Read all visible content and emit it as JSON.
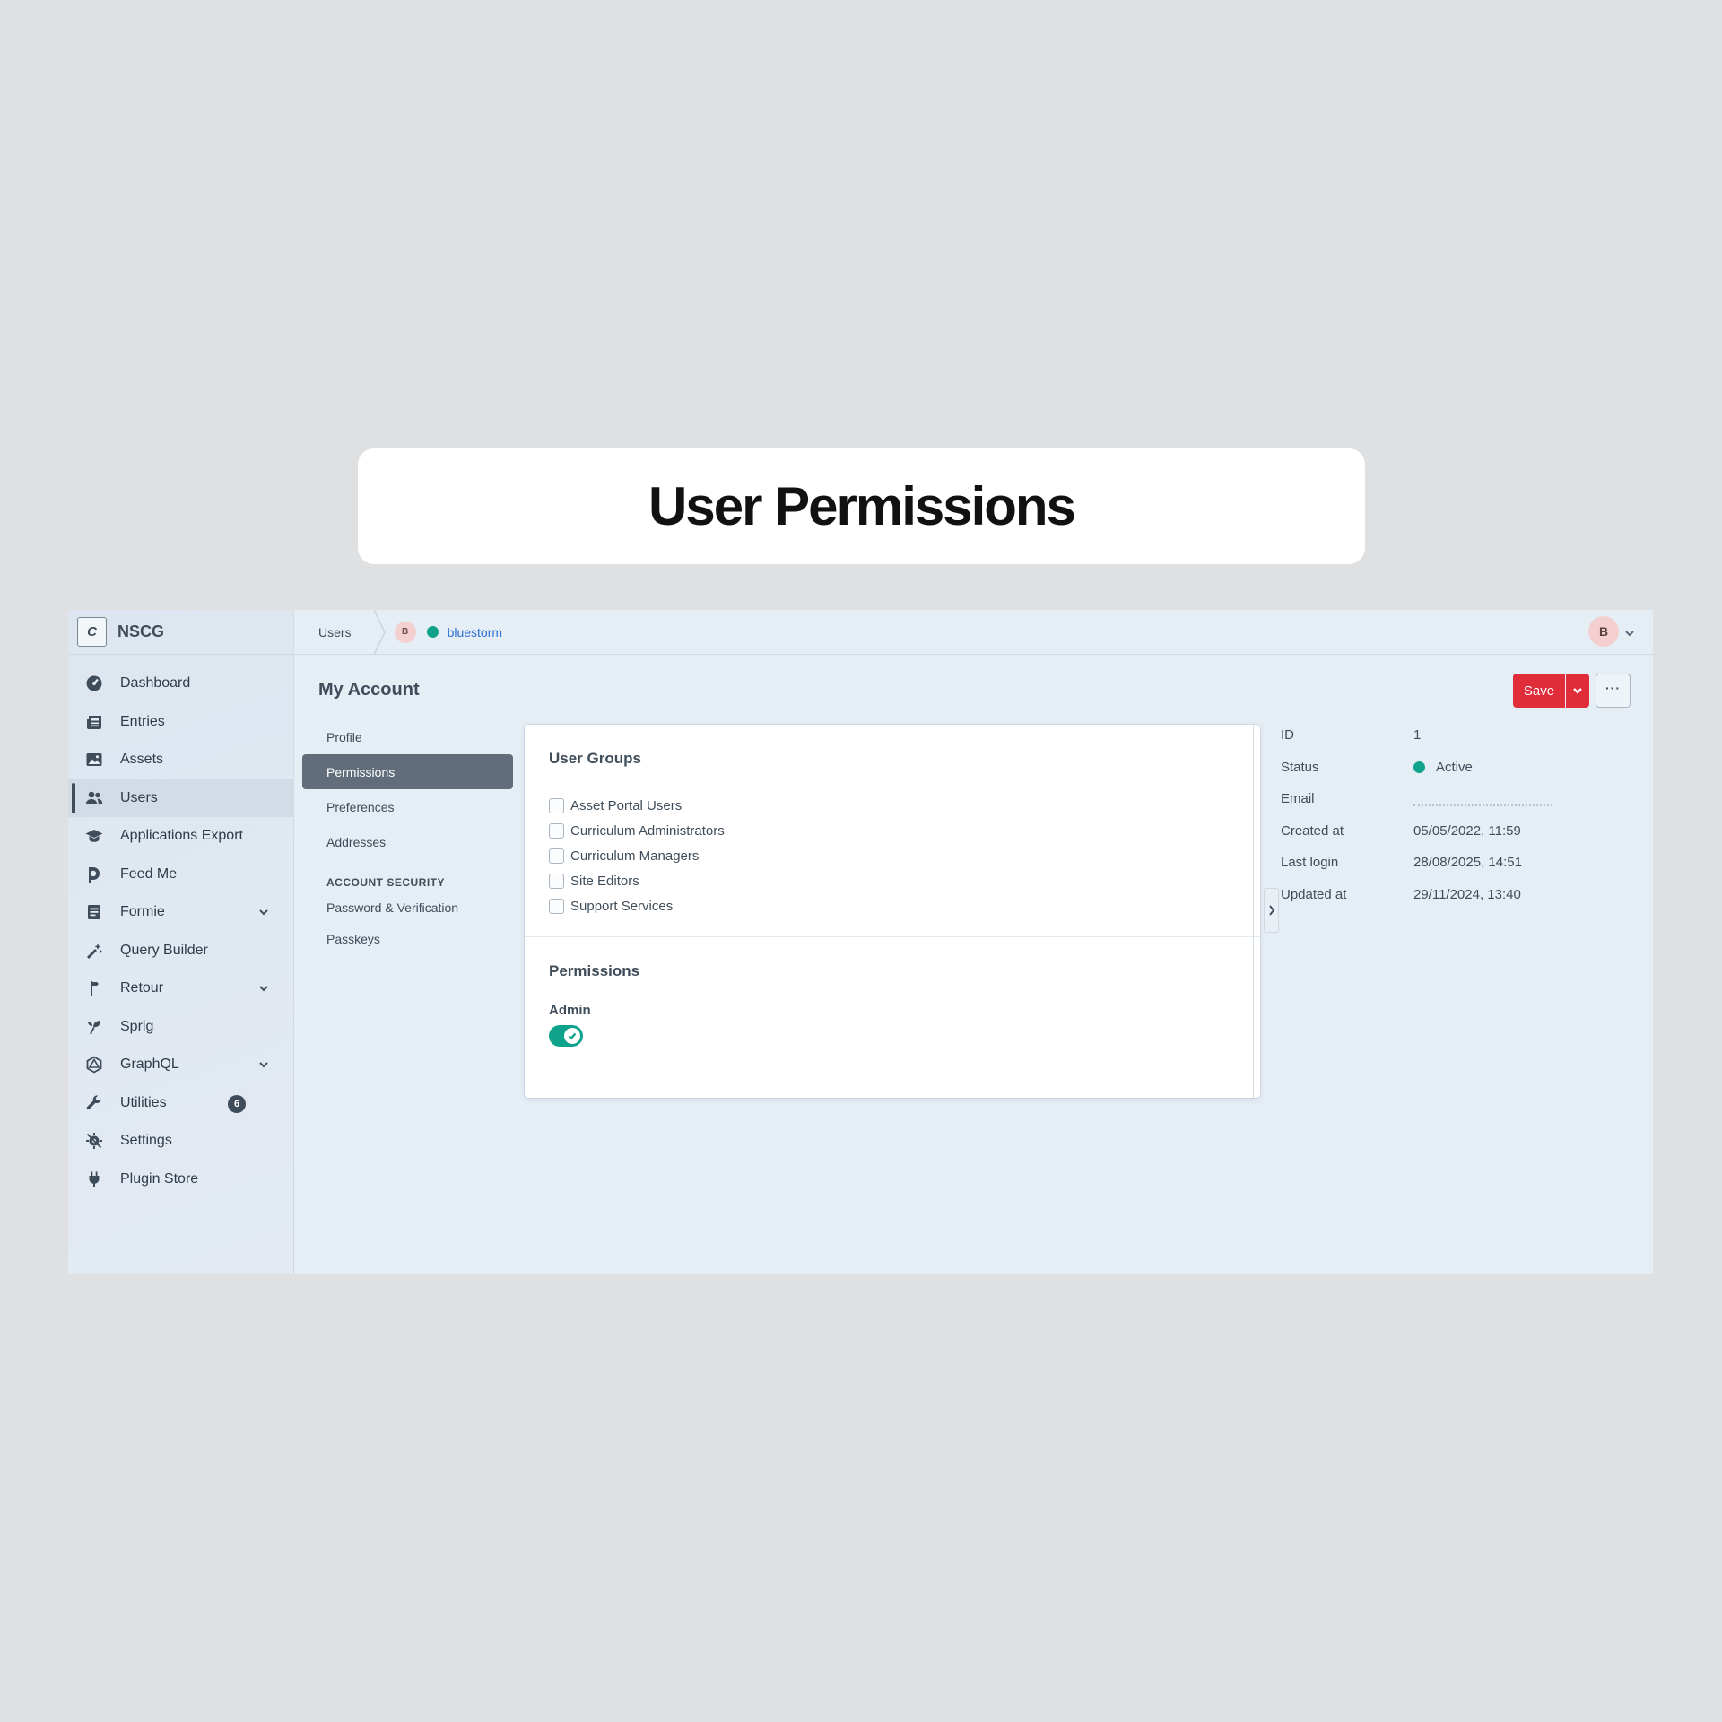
{
  "hero": {
    "title": "User Permissions"
  },
  "brand": {
    "logo": "C",
    "name": "NSCG"
  },
  "sidebar": {
    "items": [
      {
        "label": "Dashboard",
        "icon": "gauge-icon"
      },
      {
        "label": "Entries",
        "icon": "newspaper-icon"
      },
      {
        "label": "Assets",
        "icon": "image-icon"
      },
      {
        "label": "Users",
        "icon": "users-icon",
        "active": true
      },
      {
        "label": "Applications Export",
        "icon": "graduation-cap-icon"
      },
      {
        "label": "Feed Me",
        "icon": "feed-icon"
      },
      {
        "label": "Formie",
        "icon": "form-icon",
        "expandable": true
      },
      {
        "label": "Query Builder",
        "icon": "wand-icon"
      },
      {
        "label": "Retour",
        "icon": "signpost-icon",
        "expandable": true
      },
      {
        "label": "Sprig",
        "icon": "sprig-icon"
      },
      {
        "label": "GraphQL",
        "icon": "graphql-icon",
        "expandable": true
      },
      {
        "label": "Utilities",
        "icon": "wrench-icon",
        "badge": "6"
      },
      {
        "label": "Settings",
        "icon": "settings-icon"
      },
      {
        "label": "Plugin Store",
        "icon": "plug-icon"
      }
    ]
  },
  "topbar": {
    "crumb": "Users",
    "user_initial": "B",
    "user_name": "bluestorm",
    "account_initial": "B"
  },
  "page": {
    "title": "My Account",
    "save_label": "Save",
    "more_label": "···"
  },
  "subnav": {
    "items": [
      "Profile",
      "Permissions",
      "Preferences",
      "Addresses"
    ],
    "active": "Permissions",
    "security_heading": "ACCOUNT SECURITY",
    "security_items": [
      "Password & Verification",
      "Passkeys"
    ]
  },
  "user_groups": {
    "heading": "User Groups",
    "groups": [
      "Asset Portal Users",
      "Curriculum Administrators",
      "Curriculum Managers",
      "Site Editors",
      "Support Services"
    ]
  },
  "permissions": {
    "heading": "Permissions",
    "admin_label": "Admin",
    "admin_enabled": true
  },
  "meta": {
    "id_label": "ID",
    "id": "1",
    "status_label": "Status",
    "status": "Active",
    "email_label": "Email",
    "created_label": "Created at",
    "created": "05/05/2022, 11:59",
    "login_label": "Last login",
    "login": "28/08/2025, 14:51",
    "updated_label": "Updated at",
    "updated": "29/11/2024, 13:40"
  },
  "colors": {
    "accent_red": "#e12d39",
    "active_green": "#10a38b",
    "link_blue": "#2d6fd3",
    "sidebar_text": "#3f4d5a"
  }
}
